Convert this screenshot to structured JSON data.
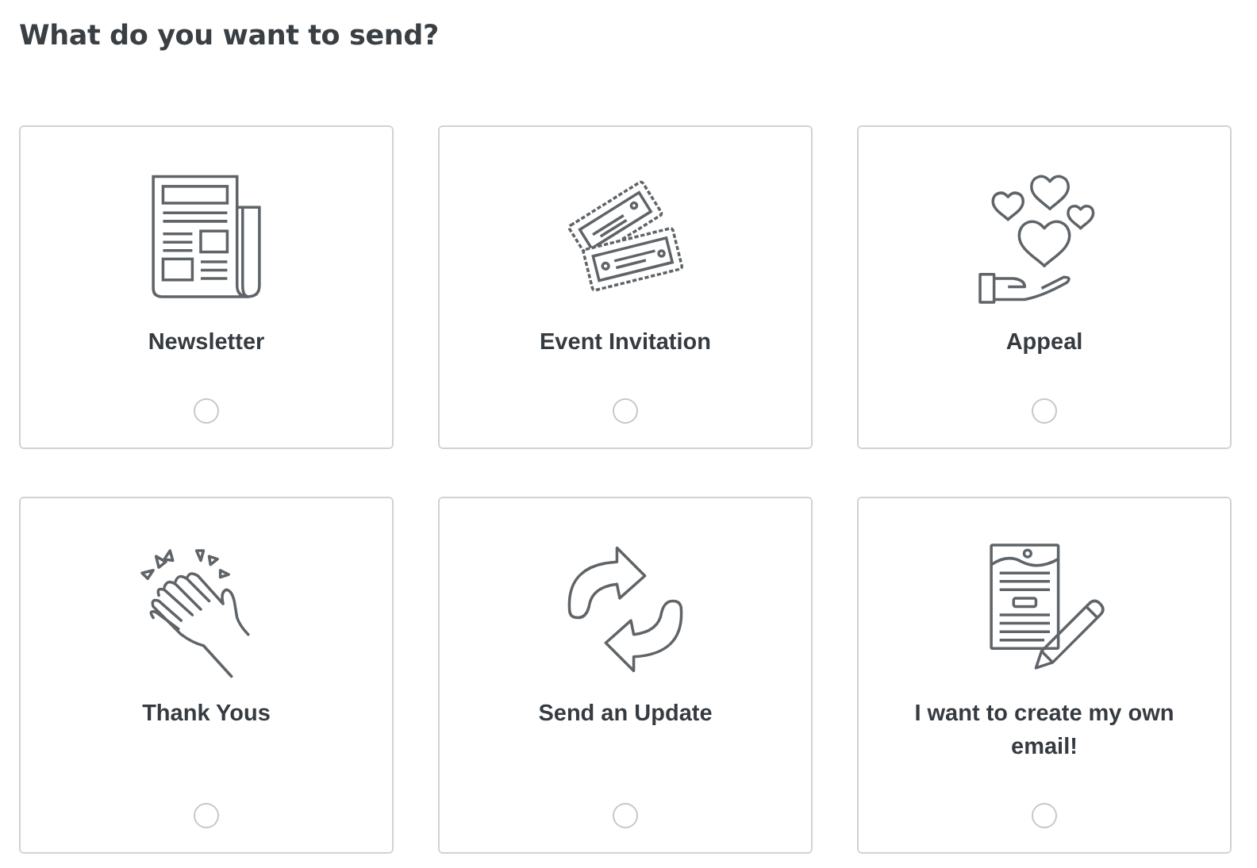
{
  "heading": "What do you want to send?",
  "options": [
    {
      "label": "Newsletter",
      "selected": false
    },
    {
      "label": "Event Invitation",
      "selected": false
    },
    {
      "label": "Appeal",
      "selected": false
    },
    {
      "label": "Thank Yous",
      "selected": false
    },
    {
      "label": "Send an Update",
      "selected": false
    },
    {
      "label": "I want to create my own email!",
      "selected": false
    }
  ]
}
